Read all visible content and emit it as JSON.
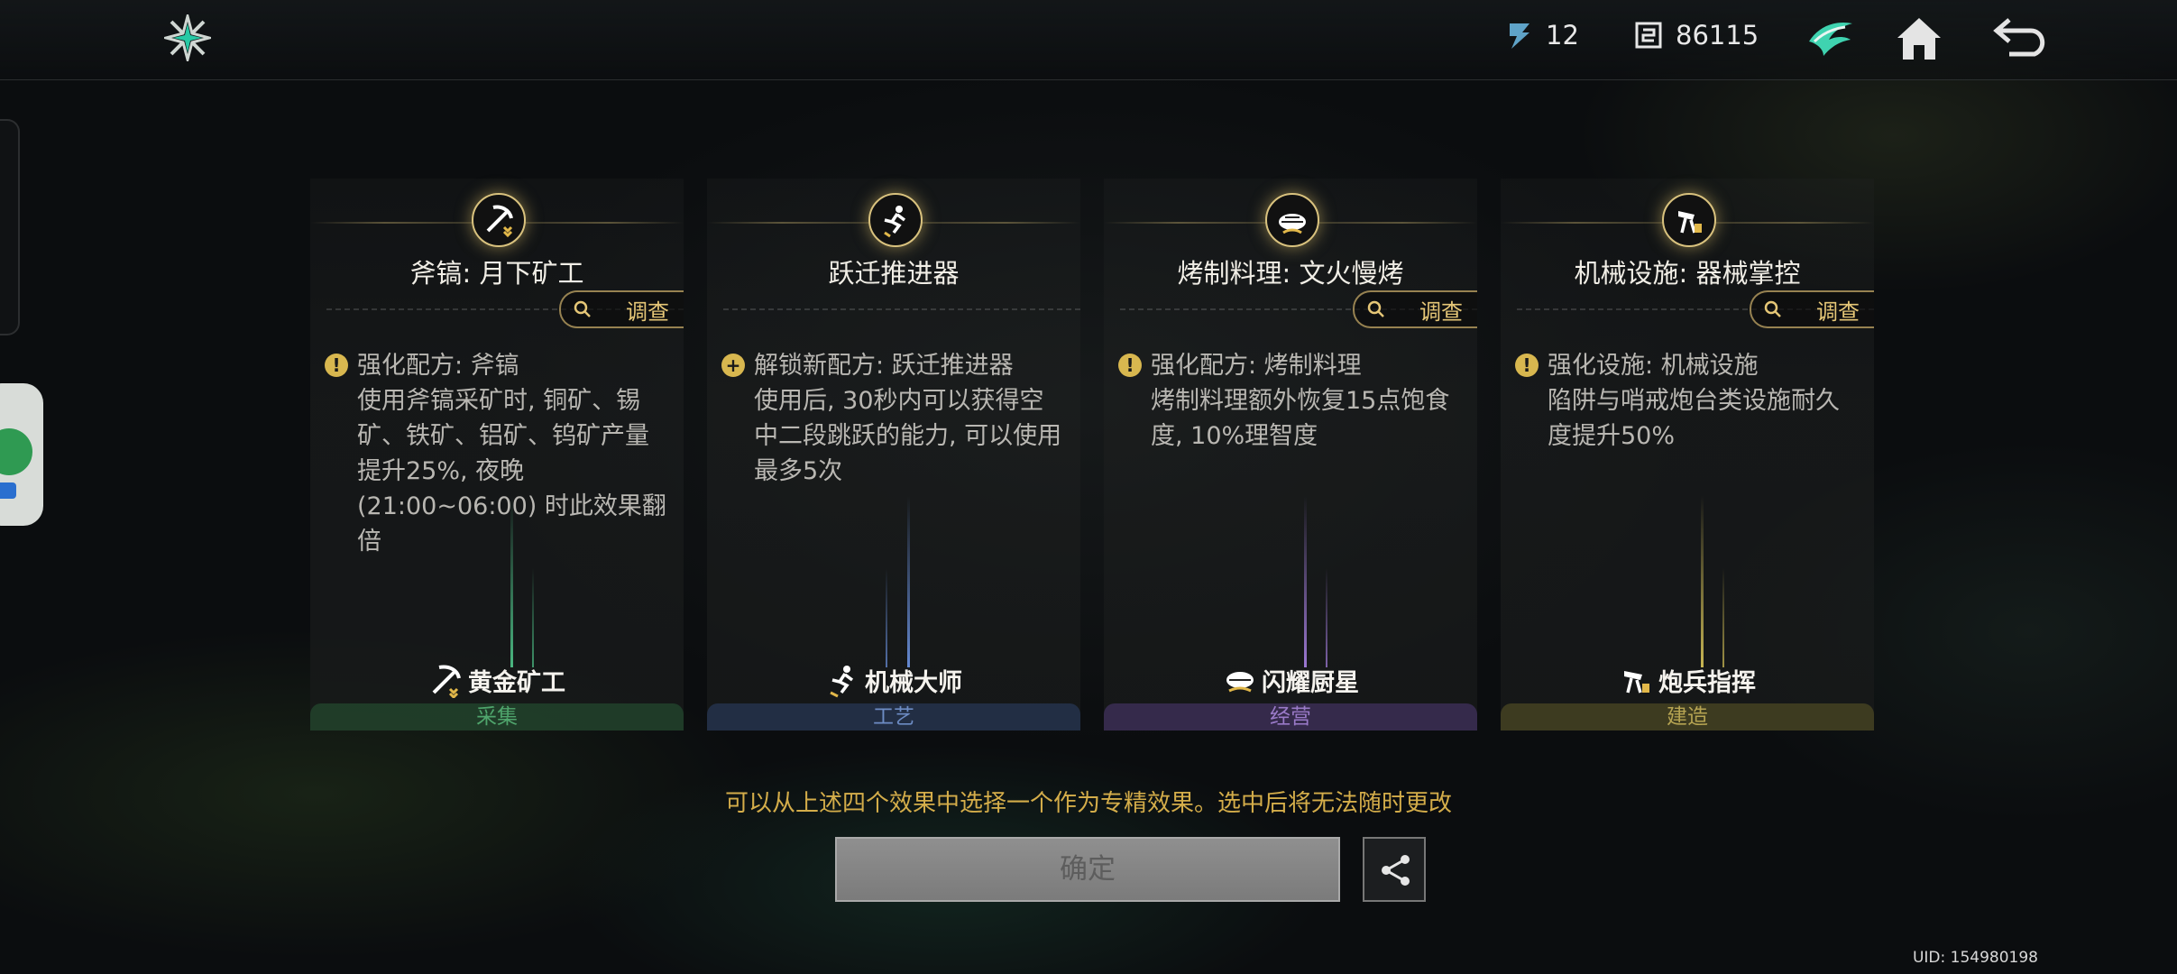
{
  "header": {
    "currency1_value": "12",
    "currency2_value": "86115",
    "icons": [
      "logo-icon",
      "energy-icon",
      "coin-icon",
      "guild-icon",
      "home-icon",
      "back-icon"
    ]
  },
  "cards": [
    {
      "title": "斧镐: 月下矿工",
      "investigate": "调查",
      "desc_head": "强化配方: 斧镐",
      "desc_body": "使用斧镐采矿时, 铜矿、锡矿、铁矿、铝矿、钨矿产量提升25%, 夜晚 (21:00~06:00) 时此效果翻倍",
      "profession": "黄金矿工",
      "category": "采集",
      "accent": "#4a9a6a"
    },
    {
      "title": "跃迁推进器",
      "investigate": "",
      "desc_head": "解锁新配方: 跃迁推进器",
      "desc_body": "使用后, 30秒内可以获得空中二段跳跃的能力, 可以使用最多5次",
      "profession": "机械大师",
      "category": "工艺",
      "accent": "#5a7ab0"
    },
    {
      "title": "烤制料理: 文火慢烤",
      "investigate": "调查",
      "desc_head": "强化配方: 烤制料理",
      "desc_body": "烤制料理额外恢复15点饱食度, 10%理智度",
      "profession": "闪耀厨星",
      "category": "经营",
      "accent": "#8a6ab8"
    },
    {
      "title": "机械设施: 器械掌控",
      "investigate": "调查",
      "desc_head": "强化设施: 机械设施",
      "desc_body": "陷阱与哨戒炮台类设施耐久度提升50%",
      "profession": "炮兵指挥",
      "category": "建造",
      "accent": "#b0a040"
    }
  ],
  "footer": {
    "hint": "可以从上述四个效果中选择一个作为专精效果。选中后将无法随时更改",
    "confirm_label": "确定",
    "uid": "UID: 154980198"
  }
}
